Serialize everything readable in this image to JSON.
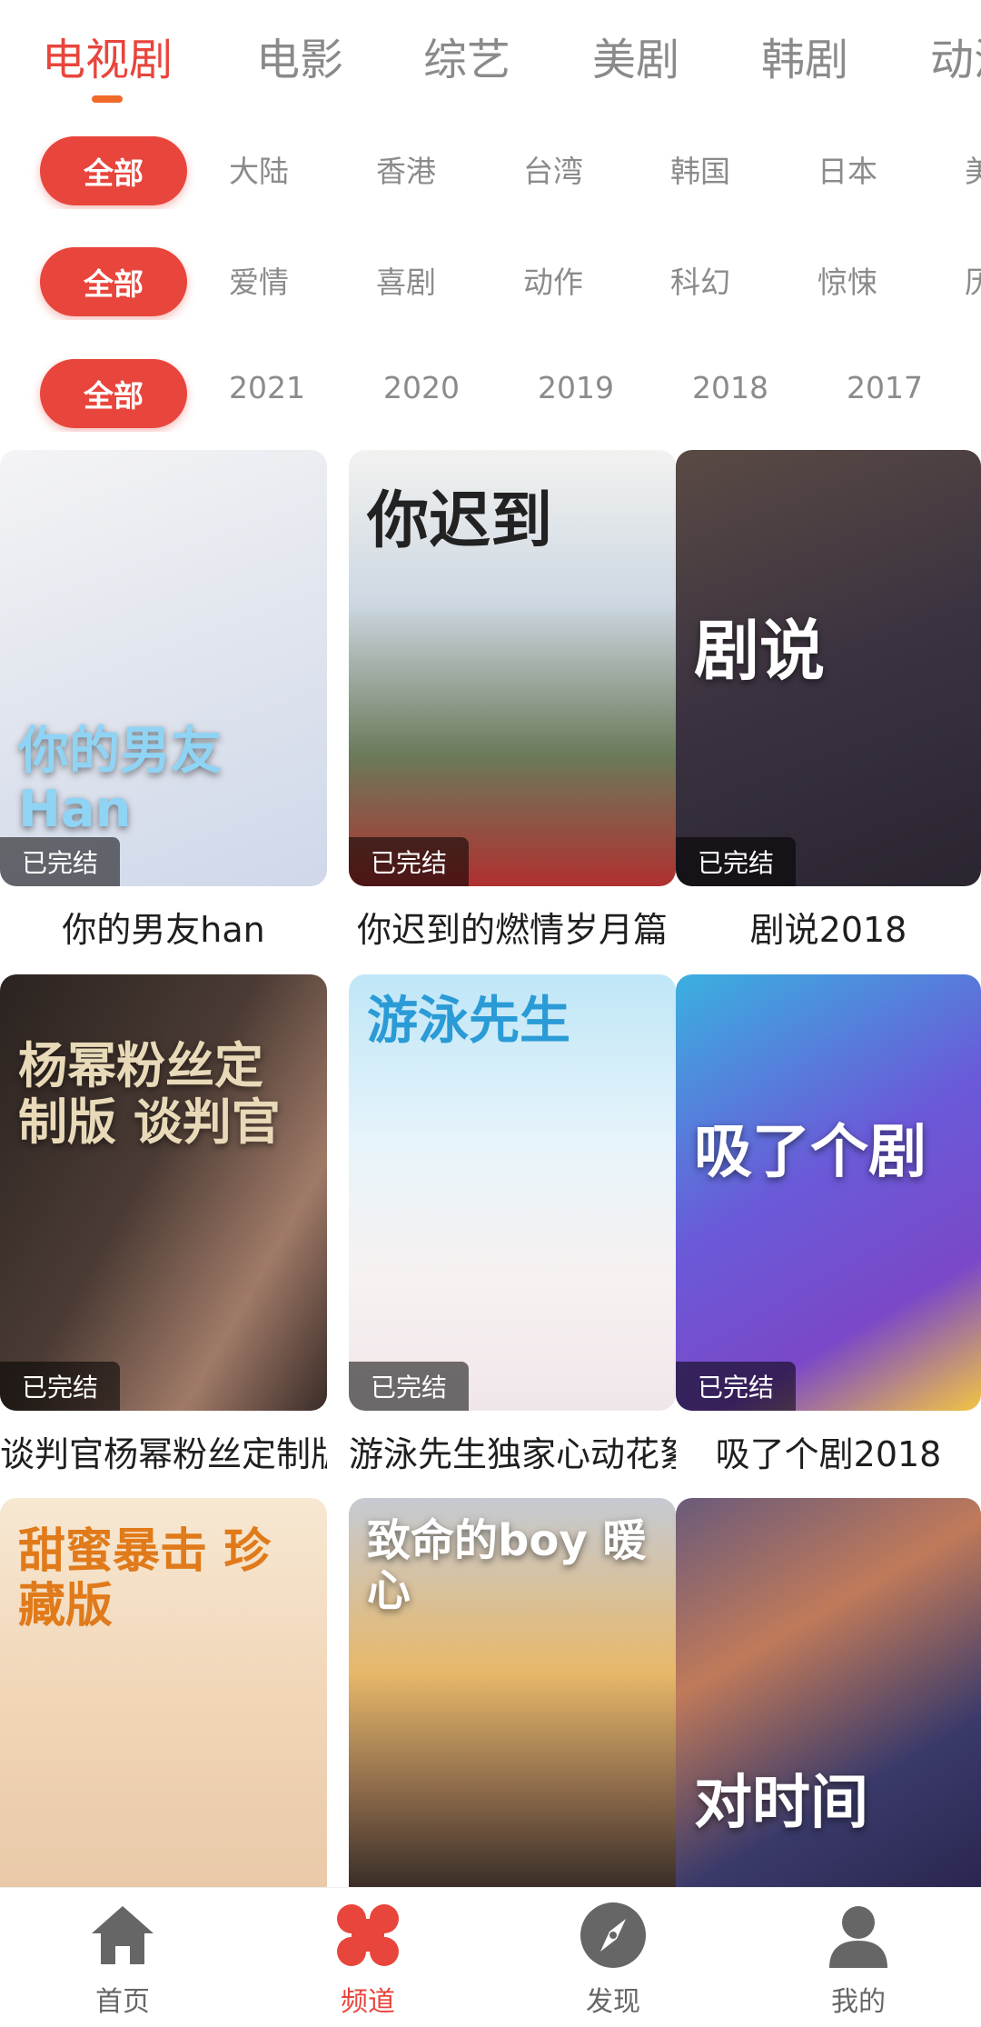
{
  "top_tabs": [
    "电视剧",
    "电影",
    "综艺",
    "美剧",
    "韩剧",
    "动漫"
  ],
  "active_tab_index": 0,
  "filters": {
    "region": {
      "all": "全部",
      "items": [
        "大陆",
        "香港",
        "台湾",
        "韩国",
        "日本",
        "美国"
      ]
    },
    "genre": {
      "all": "全部",
      "items": [
        "爱情",
        "喜剧",
        "动作",
        "科幻",
        "惊悚",
        "历史"
      ]
    },
    "year": {
      "all": "全部",
      "items": [
        "2021",
        "2020",
        "2019",
        "2018",
        "2017"
      ]
    }
  },
  "cards": [
    {
      "title": "你的男友han",
      "badge": "已完结",
      "poster_text": "你的男友 Han"
    },
    {
      "title": "你迟到的燃情岁月篇",
      "badge": "已完结",
      "poster_text": "你迟到"
    },
    {
      "title": "剧说2018",
      "badge": "已完结",
      "poster_text": "剧说"
    },
    {
      "title": "谈判官杨幂粉丝定制版",
      "badge": "已完结",
      "poster_text": "杨幂粉丝定制版 谈判官"
    },
    {
      "title": "游泳先生独家心动花絮",
      "badge": "已完结",
      "poster_text": "游泳先生"
    },
    {
      "title": "吸了个剧2018",
      "badge": "已完结",
      "poster_text": "吸了个剧"
    },
    {
      "title": "",
      "badge": "",
      "poster_text": "甜蜜暴击 珍藏版"
    },
    {
      "title": "",
      "badge": "",
      "poster_text": "致命的boy 暖心"
    },
    {
      "title": "",
      "badge": "",
      "poster_text": "对时间"
    }
  ],
  "bottom_nav": [
    {
      "label": "首页",
      "icon": "home-icon"
    },
    {
      "label": "频道",
      "icon": "clover-icon"
    },
    {
      "label": "发现",
      "icon": "compass-icon"
    },
    {
      "label": "我的",
      "icon": "user-icon"
    }
  ],
  "colors": {
    "accent": "#e8453c",
    "indicator": "#f06a2a",
    "inactive": "#8a8a8a"
  }
}
